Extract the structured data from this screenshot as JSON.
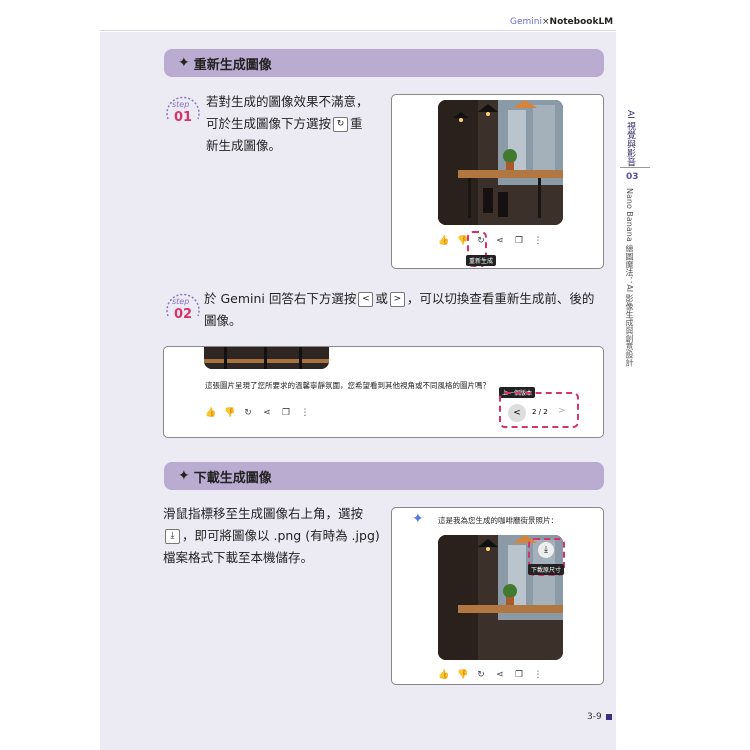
{
  "header": {
    "logo_gemini": "Gemini",
    "logo_sep": "×",
    "logo_notebook": "NotebookLM"
  },
  "side": {
    "chapter_title": "AI 視覺與影音",
    "chapter_num": "03",
    "subtitle": "Nano Banana 繪圖魔法：AI 影像生成與創意設計"
  },
  "section1": {
    "title": "重新生成圖像",
    "step1": {
      "label": "step",
      "num": "01",
      "text1": "若對生成的圖像效果不滿意，",
      "text2a": "可於生成圖像下方選按",
      "icon": "↻",
      "text2b": "重",
      "text3": "新生成圖像。"
    },
    "card1": {
      "tooltip": "重新生成"
    },
    "step2": {
      "label": "step",
      "num": "02",
      "text1a": "於 Gemini 回答右下方選按",
      "btn_prev": "<",
      "or": "或",
      "btn_next": ">",
      "text1b": "，可以切換查看重新生成前、後的",
      "text2": "圖像。"
    },
    "card2": {
      "caption": "這張圖片呈現了您所要求的溫馨寧靜氛圍，您希望看到其他視角或不同風格的圖片嗎？",
      "tooltip": "上一個版本",
      "pager": "2 / 2",
      "prev": "<",
      "next": ">"
    }
  },
  "section2": {
    "title": "下載生成圖像",
    "text1": "滑鼠指標移至生成圖像右上角，選按",
    "text2": "，即可將圖像以 .png (有時為 .jpg)",
    "text3": "檔案格式下載至本機儲存。",
    "card3": {
      "caption": "這是我為您生成的咖啡廳街景照片：",
      "tooltip": "下載原尺寸"
    }
  },
  "footer": {
    "page": "3-9"
  },
  "toolbar_icons": [
    "thumbs-up-icon",
    "thumbs-down-icon",
    "regenerate-icon",
    "share-icon",
    "copy-icon",
    "more-icon"
  ],
  "colors": {
    "section_bar": "#b9acd0",
    "accent_pink": "#d6336c",
    "page_bg": "#ecebf3"
  }
}
